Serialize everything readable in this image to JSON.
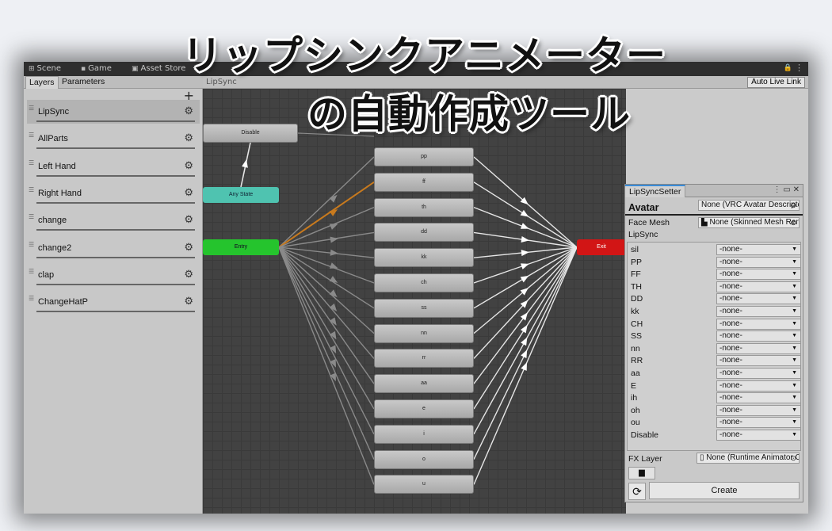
{
  "title": {
    "line1": "リップシンクアニメーター",
    "line2": "の自動作成ツール"
  },
  "top_tabs": [
    {
      "icon": "grid-icon",
      "label": "Scene"
    },
    {
      "icon": "gamepad-icon",
      "label": "Game"
    },
    {
      "icon": "store-icon",
      "label": "Asset Store"
    }
  ],
  "left": {
    "tabs": [
      "Layers",
      "Parameters"
    ],
    "add_label": "+",
    "layers": [
      "LipSync",
      "AllParts",
      "Left Hand",
      "Right Hand",
      "change",
      "change2",
      "clap",
      "ChangeHatP"
    ]
  },
  "graph": {
    "breadcrumb": "LipSync",
    "auto_live_link": "Auto Live Link",
    "disable_label": "Disable",
    "any_state_label": "Any State",
    "entry_label": "Entry",
    "exit_label": "Exit",
    "states": [
      "pp",
      "ff",
      "th",
      "dd",
      "kk",
      "ch",
      "ss",
      "nn",
      "rr",
      "aa",
      "e",
      "i",
      "o",
      "u"
    ]
  },
  "lipsync_setter": {
    "tab_label": "LipSyncSetter",
    "avatar_label": "Avatar",
    "avatar_value": "None (VRC Avatar Descriptor)",
    "face_mesh_label": "Face Mesh",
    "face_mesh_value": "None (Skinned Mesh Renderer)",
    "section_label": "LipSync",
    "none_option": "-none-",
    "phonemes": [
      "sil",
      "PP",
      "FF",
      "TH",
      "DD",
      "kk",
      "CH",
      "SS",
      "nn",
      "RR",
      "aa",
      "E",
      "ih",
      "oh",
      "ou",
      "Disable"
    ],
    "fx_layer_label": "FX Layer",
    "fx_layer_value": "None (Runtime Animator Controller)",
    "create_label": "Create"
  },
  "colors": {
    "entry": "#25c42d",
    "exit": "#d21515",
    "any_state": "#4fc3b0",
    "highlight_transition": "#c87a1e"
  }
}
